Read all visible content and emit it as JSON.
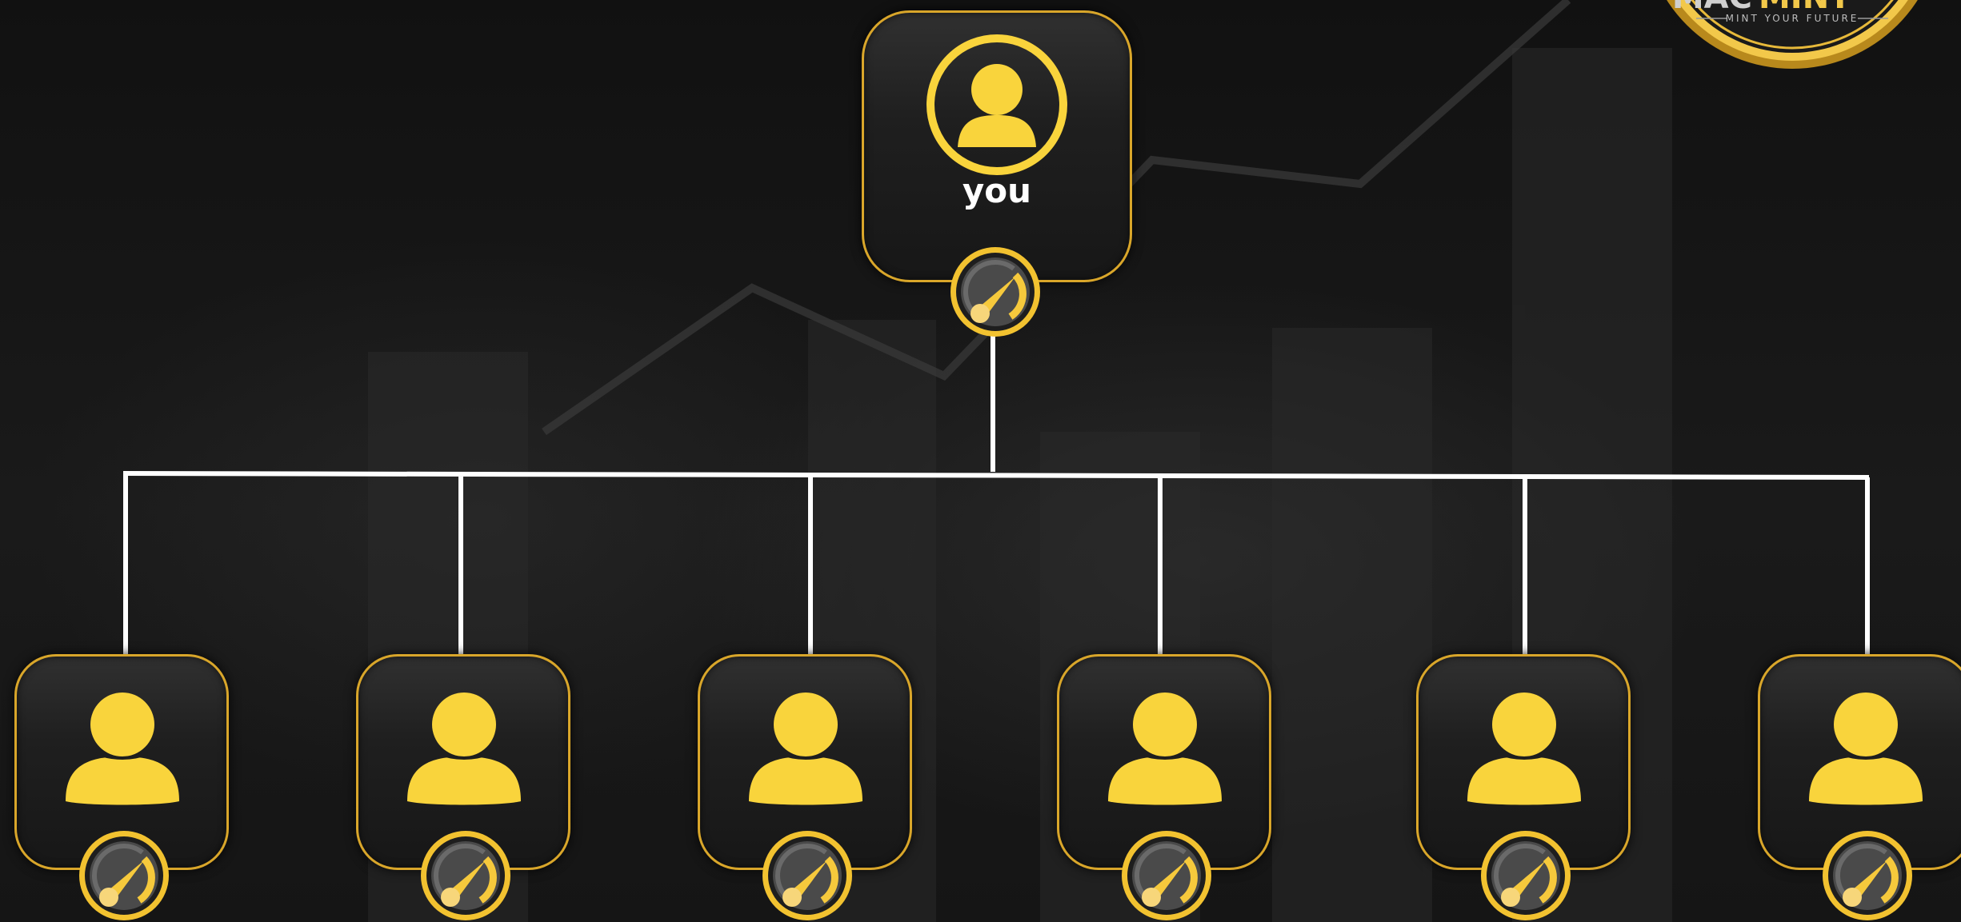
{
  "root": {
    "label": "you",
    "avatar_icon": "user-icon",
    "badge_icon": "speedometer-icon"
  },
  "children": [
    {
      "avatar_icon": "user-icon",
      "badge_icon": "speedometer-icon"
    },
    {
      "avatar_icon": "user-icon",
      "badge_icon": "speedometer-icon"
    },
    {
      "avatar_icon": "user-icon",
      "badge_icon": "speedometer-icon"
    },
    {
      "avatar_icon": "user-icon",
      "badge_icon": "speedometer-icon"
    },
    {
      "avatar_icon": "user-icon",
      "badge_icon": "speedometer-icon"
    },
    {
      "avatar_icon": "user-icon",
      "badge_icon": "speedometer-icon"
    }
  ],
  "logo": {
    "title_part1": "MAC",
    "title_part2": "MINT",
    "tagline": "MINT YOUR FUTURE"
  },
  "colors": {
    "accent": "#f9d43c",
    "border": "#d9a62a",
    "connector": "#ffffff",
    "background": "#111111"
  }
}
